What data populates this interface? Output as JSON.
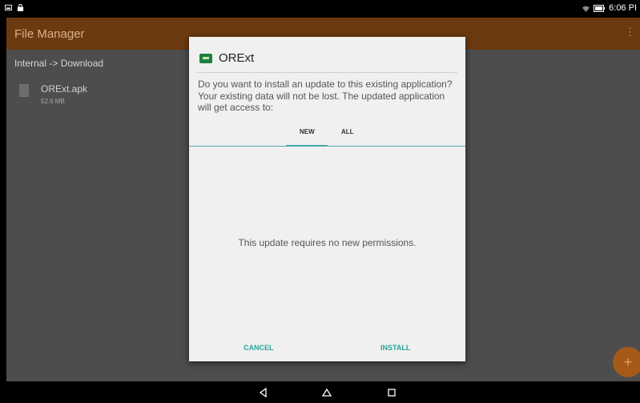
{
  "status_bar": {
    "icons_left": [
      "image-icon",
      "lock-icon"
    ],
    "icons_right": [
      "wifi-icon",
      "battery-icon"
    ],
    "time": "6:06 PI"
  },
  "app_bar": {
    "title": "File Manager",
    "menu_icon": "more-vert-icon"
  },
  "file_manager": {
    "breadcrumb": "Internal -> Download",
    "files": [
      {
        "name": "ORExt.apk",
        "size": "52.6 MB"
      }
    ],
    "fab_label": "+"
  },
  "dialog": {
    "app_name": "ORExt",
    "message": "Do you want to install an update to this existing application? Your existing data will not be lost. The updated application will get access to:",
    "tabs": [
      {
        "label": "NEW",
        "selected": true
      },
      {
        "label": "ALL",
        "selected": false
      }
    ],
    "permission_text": "This update requires no new permissions.",
    "cancel_label": "CANCEL",
    "install_label": "INSTALL"
  },
  "nav_bar": {
    "buttons": [
      "back-icon",
      "home-icon",
      "recents-icon"
    ]
  },
  "colors": {
    "accent": "#26a69a",
    "app_bar": "#6b3a10",
    "fab": "#a55a1a",
    "scrim": "#4d4d4d"
  }
}
